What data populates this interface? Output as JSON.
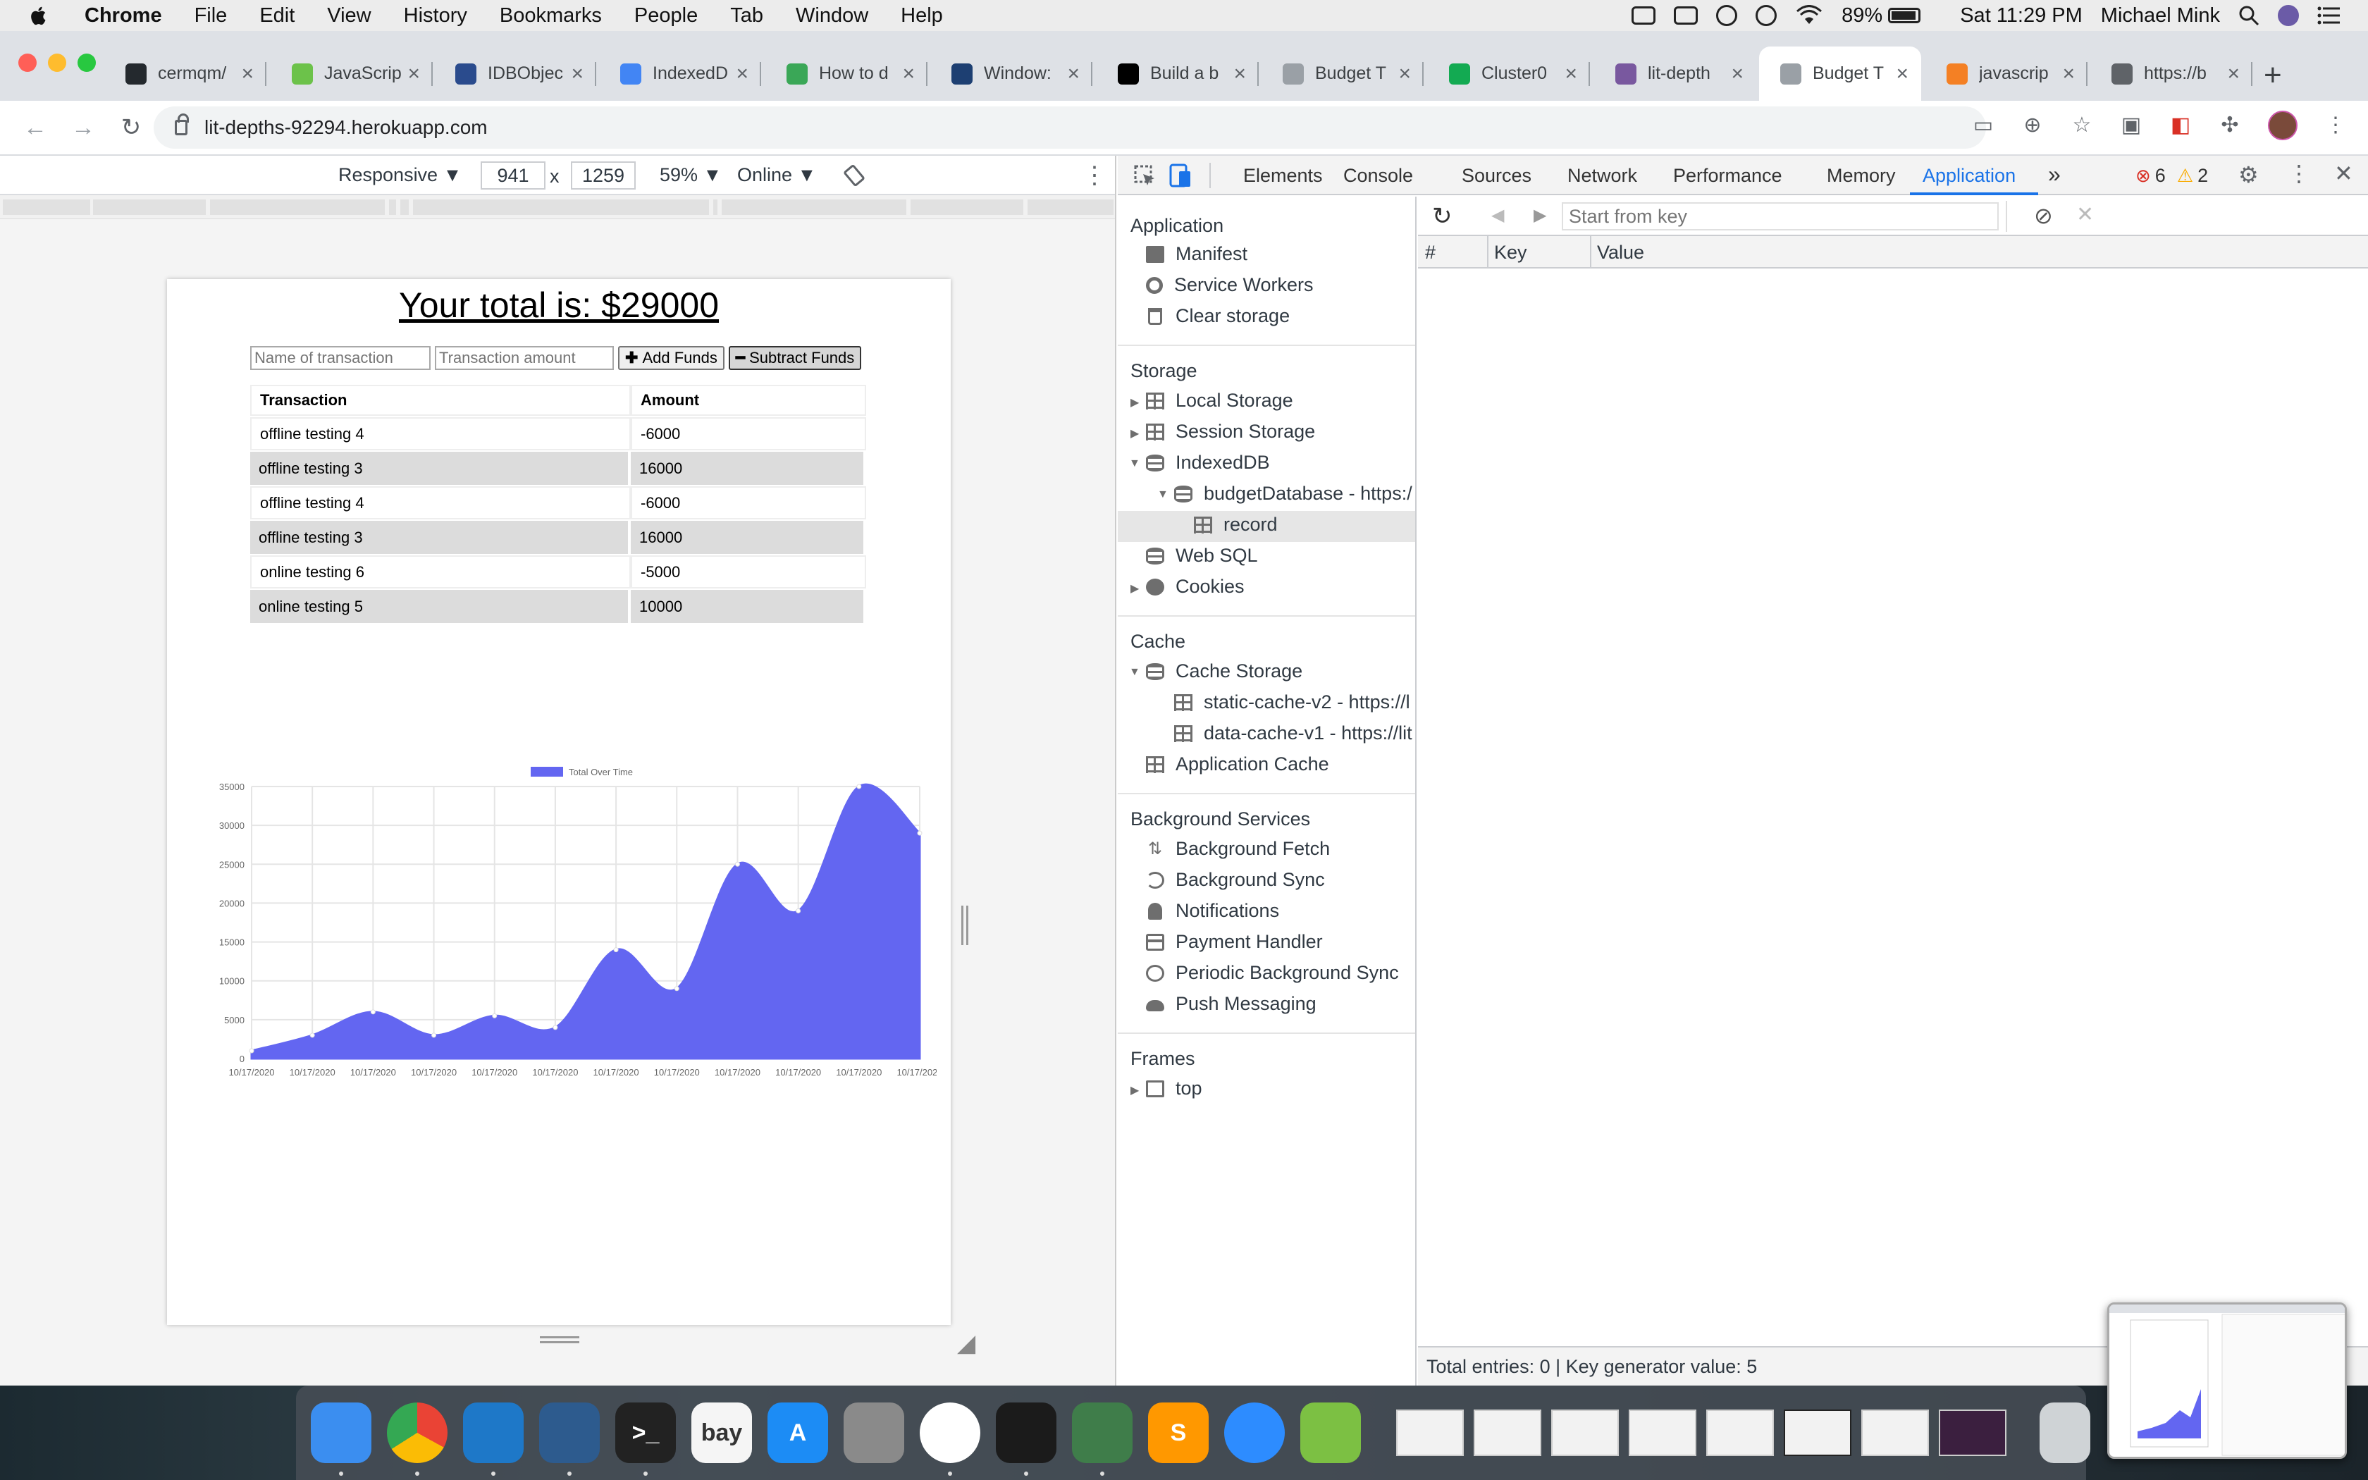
{
  "menubar": {
    "app": "Chrome",
    "menus": [
      "File",
      "Edit",
      "View",
      "History",
      "Bookmarks",
      "People",
      "Tab",
      "Window",
      "Help"
    ],
    "battery": "89%",
    "clock": "Sat 11:29 PM",
    "user": "Michael Mink"
  },
  "tabs": [
    {
      "title": "cermqm/",
      "color": "#24292e"
    },
    {
      "title": "JavaScrip",
      "color": "#6cc24a"
    },
    {
      "title": "IDBObjec",
      "color": "#2a4b8d"
    },
    {
      "title": "IndexedD",
      "color": "#4285f4"
    },
    {
      "title": "How to d",
      "color": "#3aa757"
    },
    {
      "title": "Window:",
      "color": "#1d3f72"
    },
    {
      "title": "Build a b",
      "color": "#000000"
    },
    {
      "title": "Budget T",
      "color": "#9aa0a6"
    },
    {
      "title": "Cluster0",
      "color": "#13aa52"
    },
    {
      "title": "lit-depth",
      "color": "#79589f"
    },
    {
      "title": "Budget T",
      "color": "#9aa0a6"
    },
    {
      "title": "javascrip",
      "color": "#f48024"
    },
    {
      "title": "https://b",
      "color": "#5f6368"
    }
  ],
  "address": "lit-depths-92294.herokuapp.com",
  "device_toolbar": {
    "mode": "Responsive ▼",
    "width": "941",
    "times": "x",
    "height": "1259",
    "zoom": "59% ▼",
    "network": "Online ▼"
  },
  "app_page": {
    "title": "Your total is: $29000",
    "name_placeholder": "Name of transaction",
    "amount_placeholder": "Transaction amount",
    "add_label": "Add Funds",
    "subtract_label": "Subtract Funds",
    "table_headers": [
      "Transaction",
      "Amount"
    ],
    "rows": [
      {
        "name": "offline testing 4",
        "amount": "-6000"
      },
      {
        "name": "offline testing 3",
        "amount": "16000"
      },
      {
        "name": "offline testing 4",
        "amount": "-6000"
      },
      {
        "name": "offline testing 3",
        "amount": "16000"
      },
      {
        "name": "online testing 6",
        "amount": "-5000"
      },
      {
        "name": "online testing 5",
        "amount": "10000"
      }
    ]
  },
  "chart_data": {
    "type": "area",
    "legend": "Total Over Time",
    "legend_position": "top",
    "x": [
      "10/17/2020",
      "10/17/2020",
      "10/17/2020",
      "10/17/2020",
      "10/17/2020",
      "10/17/2020",
      "10/17/2020",
      "10/17/2020",
      "10/17/2020",
      "10/17/2020",
      "10/17/2020",
      "10/17/2020"
    ],
    "values": [
      1000,
      3000,
      6000,
      3000,
      5500,
      4000,
      14000,
      9000,
      25000,
      19000,
      35000,
      29000
    ],
    "ylim": [
      0,
      35000
    ],
    "yticks": [
      "0",
      "5000",
      "10000",
      "15000",
      "20000",
      "25000",
      "30000",
      "35000"
    ],
    "grid": true,
    "color": "#6366f1"
  },
  "devtools": {
    "tabs": [
      "Elements",
      "Console",
      "Sources",
      "Network",
      "Performance",
      "Memory",
      "Application"
    ],
    "more": "»",
    "errors": "6",
    "warnings": "2",
    "sections": {
      "application": {
        "title": "Application",
        "items": [
          "Manifest",
          "Service Workers",
          "Clear storage"
        ]
      },
      "storage": {
        "title": "Storage",
        "items": [
          "Local Storage",
          "Session Storage",
          "IndexedDB",
          "budgetDatabase - https:/",
          "record",
          "Web SQL",
          "Cookies"
        ]
      },
      "cache": {
        "title": "Cache",
        "items": [
          "Cache Storage",
          "static-cache-v2 - https://l",
          "data-cache-v1 - https://lit",
          "Application Cache"
        ]
      },
      "background": {
        "title": "Background Services",
        "items": [
          "Background Fetch",
          "Background Sync",
          "Notifications",
          "Payment Handler",
          "Periodic Background Sync",
          "Push Messaging"
        ]
      },
      "frames": {
        "title": "Frames",
        "items": [
          "top"
        ]
      }
    },
    "idb": {
      "start_placeholder": "Start from key",
      "columns": [
        "#",
        "Key",
        "Value"
      ],
      "status": "Total entries: 0 | Key generator value: 5"
    }
  },
  "dock": {
    "apps": [
      {
        "name": "Finder",
        "color": "#3b8ef0",
        "glyph": ""
      },
      {
        "name": "Chrome",
        "color": "#e8e8e8",
        "glyph": ""
      },
      {
        "name": "VS Code",
        "color": "#1e78c8",
        "glyph": ""
      },
      {
        "name": "MySQL Workbench",
        "color": "#2d5b8e",
        "glyph": ""
      },
      {
        "name": "Terminal",
        "color": "#222222",
        "glyph": ">_"
      },
      {
        "name": "eBay",
        "color": "#f5f5f5",
        "glyph": "bay"
      },
      {
        "name": "App Store",
        "color": "#1c8cf5",
        "glyph": "A"
      },
      {
        "name": "System Preferences",
        "color": "#8a8a8a",
        "glyph": ""
      },
      {
        "name": "Slack",
        "color": "#ffffff",
        "glyph": ""
      },
      {
        "name": "Activity Monitor",
        "color": "#1b1b1b",
        "glyph": ""
      },
      {
        "name": "Robo 3T",
        "color": "#3f7d4a",
        "glyph": ""
      },
      {
        "name": "Sublime Text",
        "color": "#ff9800",
        "glyph": "S"
      },
      {
        "name": "Zoom",
        "color": "#2d8cff",
        "glyph": ""
      },
      {
        "name": "Downloads",
        "color": "#7cc043",
        "glyph": ""
      }
    ]
  }
}
